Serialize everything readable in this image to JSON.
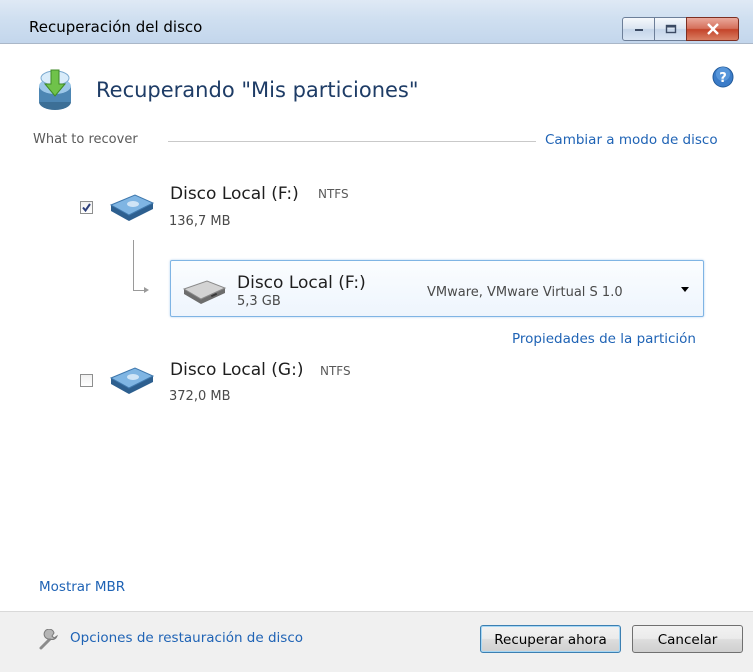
{
  "window": {
    "title": "Recuperación del disco",
    "controls": [
      "minimize-icon",
      "maximize-icon",
      "close-icon"
    ]
  },
  "header": {
    "title": "Recuperando \"Mis particiones\"",
    "icon": "disk-recovery-icon",
    "help_icon": "help-icon"
  },
  "section": {
    "label": "What to recover",
    "mode_link": "Cambiar a modo de disco"
  },
  "disks": [
    {
      "name": "Disco Local (F:)",
      "fs": "NTFS",
      "size": "136,7 MB",
      "checked": true
    },
    {
      "name": "Disco Local (G:)",
      "fs": "NTFS",
      "size": "372,0 MB",
      "checked": false
    }
  ],
  "target": {
    "name": "Disco Local (F:)",
    "size": "5,3 GB",
    "model": "VMware, VMware Virtual S 1.0",
    "properties_link": "Propiedades de la partición"
  },
  "links": {
    "mbr": "Mostrar MBR"
  },
  "footer": {
    "restore_options": "Opciones de restauración de disco",
    "recover_button": "Recuperar ahora",
    "cancel_button": "Cancelar"
  },
  "colors": {
    "link": "#1f63b5",
    "title": "#1e3c66",
    "accent_border": "#7fb4e4"
  }
}
